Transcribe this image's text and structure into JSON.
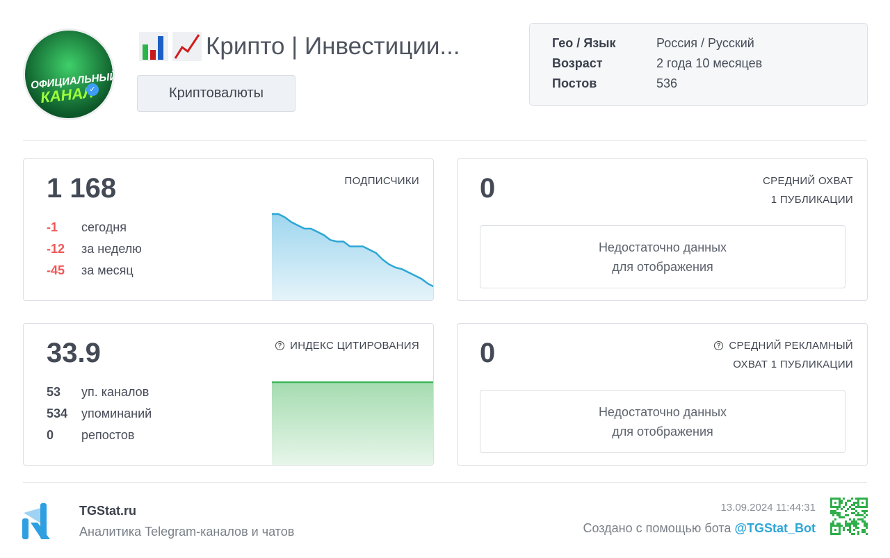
{
  "channel": {
    "title": "Крипто | Инвестиции...",
    "title_emoji": [
      "bar-chart-emoji",
      "chart-increasing-emoji"
    ],
    "category": "Криптовалюты",
    "avatar_text": [
      "ОФИЦИАЛЬНЫЙ",
      "КАНАЛ"
    ]
  },
  "info": [
    {
      "key": "Гео / Язык",
      "value": "Россия / Русский"
    },
    {
      "key": "Возраст",
      "value": "2 года 10 месяцев"
    },
    {
      "key": "Постов",
      "value": "536"
    }
  ],
  "subscribers": {
    "value": "1 168",
    "label": "ПОДПИСЧИКИ",
    "stats": [
      {
        "n": "-1",
        "t": "сегодня"
      },
      {
        "n": "-12",
        "t": "за неделю"
      },
      {
        "n": "-45",
        "t": "за месяц"
      }
    ]
  },
  "reach": {
    "value": "0",
    "label": [
      "СРЕДНИЙ ОХВАТ",
      "1 ПУБЛИКАЦИИ"
    ],
    "nodata": [
      "Недостаточно данных",
      "для отображения"
    ]
  },
  "citation": {
    "value": "33.9",
    "label": "ИНДЕКС ЦИТИРОВАНИЯ",
    "stats": [
      {
        "n": "53",
        "t": "уп. каналов"
      },
      {
        "n": "534",
        "t": "упоминаний"
      },
      {
        "n": "0",
        "t": "репостов"
      }
    ]
  },
  "ad_reach": {
    "value": "0",
    "label": [
      "СРЕДНИЙ РЕКЛАМНЫЙ",
      "ОХВАТ 1 ПУБЛИКАЦИИ"
    ],
    "nodata": [
      "Недостаточно данных",
      "для отображения"
    ]
  },
  "footer": {
    "brand": "TGStat.ru",
    "tagline": "Аналитика Telegram-каналов и чатов",
    "timestamp": "13.09.2024 11:44:31",
    "created_by": "Создано с помощью бота",
    "bot": "@TGStat_Bot"
  },
  "colors": {
    "negative": "#ee5757",
    "sub_line": "#2ea6d6",
    "cit_line": "#3cb65a",
    "link": "#2ea6d6"
  },
  "chart_data": [
    {
      "type": "area",
      "name": "subscribers-trend",
      "values": [
        1213,
        1213,
        1211,
        1208,
        1206,
        1204,
        1204,
        1202,
        1200,
        1197,
        1196,
        1196,
        1193,
        1193,
        1193,
        1191,
        1189,
        1185,
        1182,
        1180,
        1179,
        1177,
        1175,
        1173,
        1170,
        1168
      ]
    },
    {
      "type": "area",
      "name": "citation-trend",
      "values": [
        33.9,
        33.9,
        33.9,
        33.9,
        33.9,
        33.9
      ]
    }
  ]
}
